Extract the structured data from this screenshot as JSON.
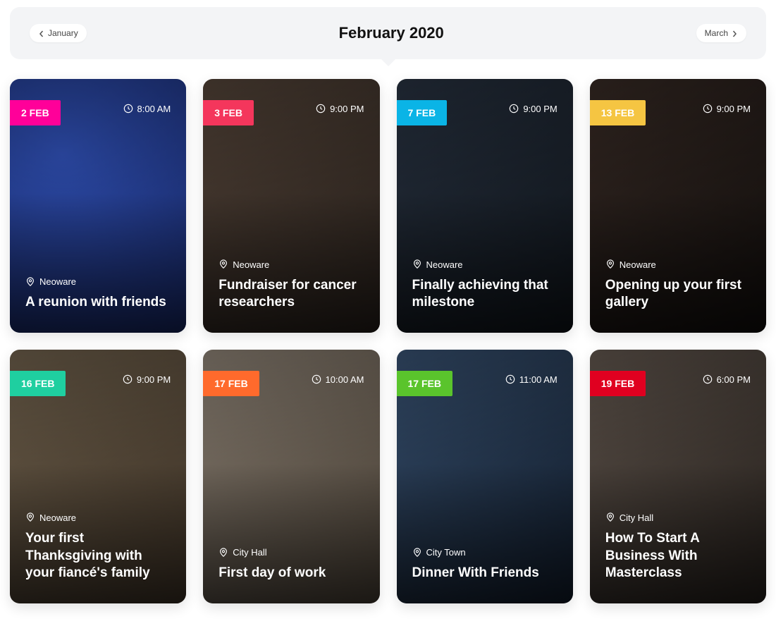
{
  "nav": {
    "prev": "January",
    "current": "February 2020",
    "next": "March"
  },
  "events": [
    {
      "date": "2 FEB",
      "tag_color": "#ff0099",
      "time": "8:00 AM",
      "location": "Neoware",
      "title": "A reunion with friends"
    },
    {
      "date": "3 FEB",
      "tag_color": "#f4365c",
      "time": "9:00 PM",
      "location": "Neoware",
      "title": "Fundraiser for cancer researchers"
    },
    {
      "date": "7 FEB",
      "tag_color": "#0ab4e6",
      "time": "9:00 PM",
      "location": "Neoware",
      "title": "Finally achieving that milestone"
    },
    {
      "date": "13 FEB",
      "tag_color": "#f5c542",
      "time": "9:00 PM",
      "location": "Neoware",
      "title": "Opening up your first gallery"
    },
    {
      "date": "16 FEB",
      "tag_color": "#1fcfa0",
      "time": "9:00 PM",
      "location": "Neoware",
      "title": "Your first Thanksgiving with your fiancé's family"
    },
    {
      "date": "17 FEB",
      "tag_color": "#ff6a2c",
      "time": "10:00 AM",
      "location": "City Hall",
      "title": "First day of work"
    },
    {
      "date": "17 FEB",
      "tag_color": "#5ac42c",
      "time": "11:00 AM",
      "location": "City Town",
      "title": "Dinner With Friends"
    },
    {
      "date": "19 FEB",
      "tag_color": "#e00020",
      "time": "6:00 PM",
      "location": "City Hall",
      "title": "How To Start A Business With Masterclass"
    }
  ]
}
